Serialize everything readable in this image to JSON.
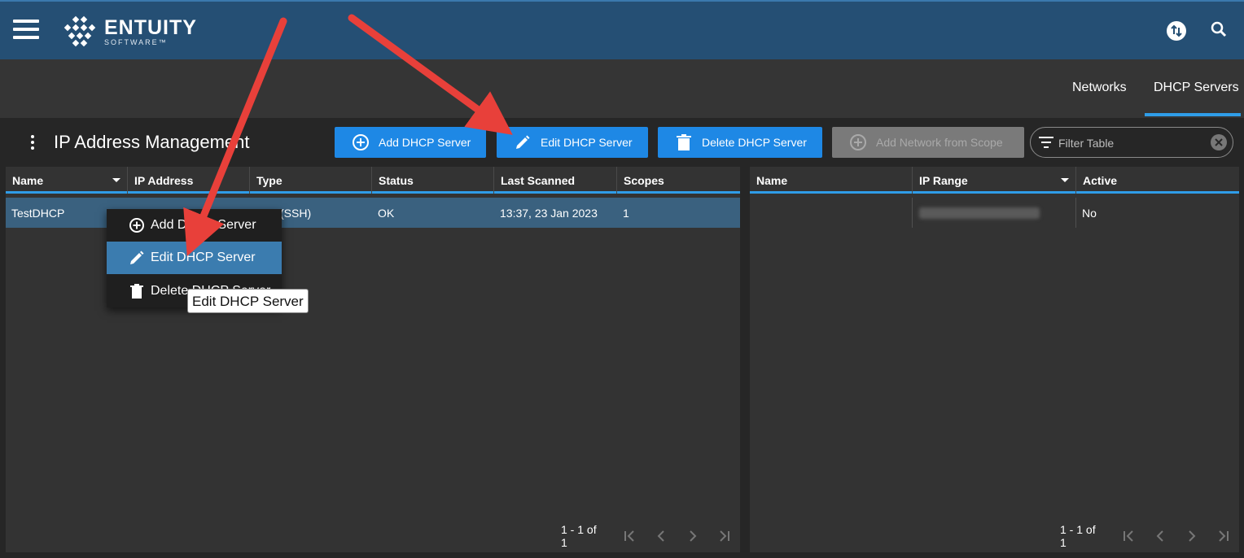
{
  "header": {
    "logo_name": "ENTUITY",
    "logo_sub": "SOFTWARE™"
  },
  "nav": {
    "tabs": [
      {
        "label": "Networks"
      },
      {
        "label": "DHCP Servers"
      }
    ],
    "active": "DHCP Servers"
  },
  "toolbar": {
    "title": "IP Address Management",
    "add_label": "Add DHCP Server",
    "edit_label": "Edit DHCP Server",
    "delete_label": "Delete DHCP Server",
    "add_network_label": "Add Network from Scope",
    "filter_placeholder": "Filter Table"
  },
  "servers_table": {
    "columns": [
      "Name",
      "IP Address",
      "Type",
      "Status",
      "Last Scanned",
      "Scopes"
    ],
    "rows": [
      {
        "name": "TestDHCP",
        "ip": "",
        "type": "(SSH)",
        "status": "OK",
        "last_scanned": "13:37, 23 Jan 2023",
        "scopes": "1"
      }
    ],
    "pager": "1 - 1 of 1"
  },
  "scopes_table": {
    "columns": [
      "Name",
      "IP Range",
      "Active"
    ],
    "rows": [
      {
        "name": "",
        "ip_range": "",
        "active": "No"
      }
    ],
    "pager": "1 - 1 of 1"
  },
  "context_menu": {
    "items": [
      {
        "label": "Add DHCP Server"
      },
      {
        "label": "Edit DHCP Server"
      },
      {
        "label": "Delete DHCP Server"
      }
    ],
    "tooltip": "Edit DHCP Server"
  },
  "colors": {
    "header_bg": "#254f74",
    "accent": "#2f9de8",
    "button": "#1e88e5",
    "selected_row": "#3a617f",
    "arrow": "#e8403a"
  }
}
